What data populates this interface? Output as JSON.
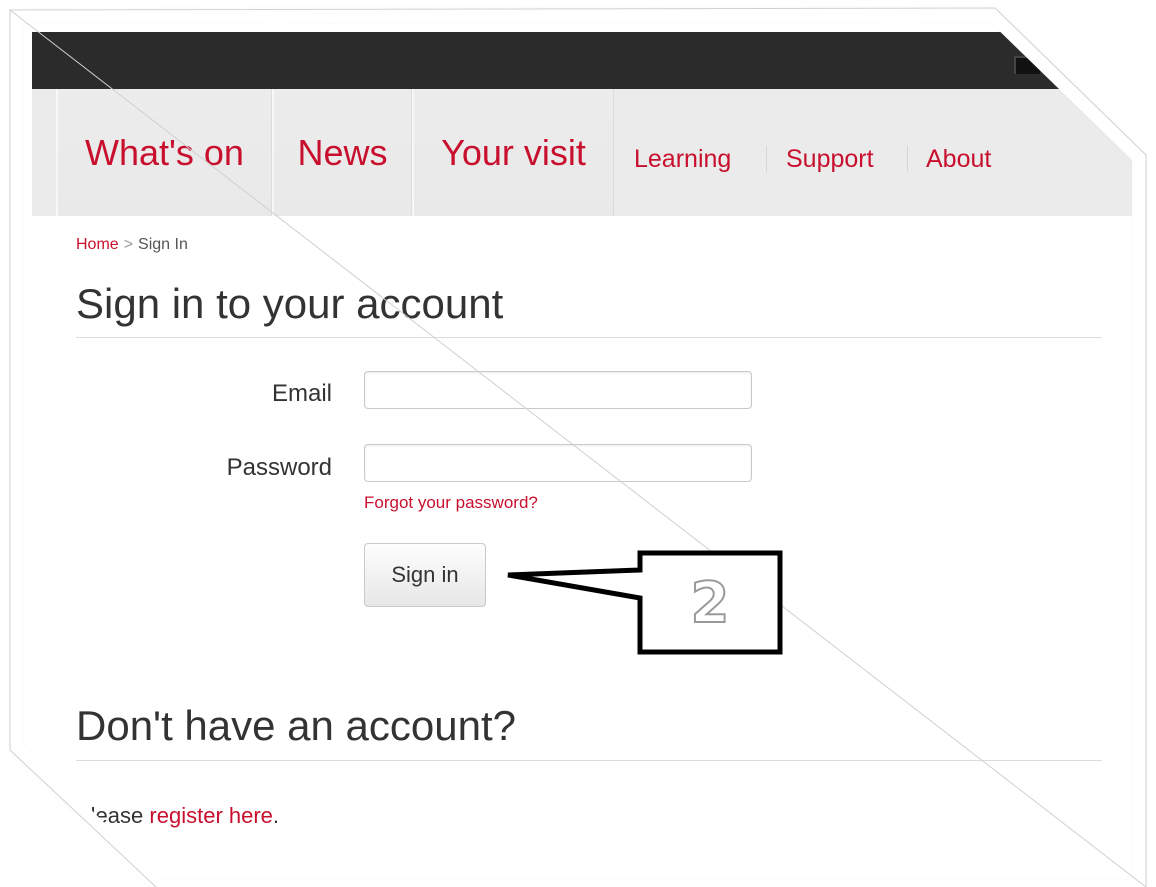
{
  "nav": {
    "primary": [
      "What's on",
      "News",
      "Your visit"
    ],
    "secondary": [
      "Learning",
      "Support",
      "About"
    ]
  },
  "breadcrumb": {
    "home": "Home",
    "separator": ">",
    "current": "Sign In"
  },
  "signin": {
    "heading": "Sign in to your account",
    "email_label": "Email",
    "email_value": "",
    "password_label": "Password",
    "password_value": "",
    "forgot_link": "Forgot your password?",
    "button_label": "Sign in"
  },
  "callout": {
    "number": "2"
  },
  "register": {
    "heading": "Don't have an account?",
    "prefix": "Please",
    "link": "register here",
    "suffix": "."
  },
  "colors": {
    "accent": "#c8102e",
    "topbar": "#2b2b2b",
    "nav_bg": "#ebebeb"
  }
}
